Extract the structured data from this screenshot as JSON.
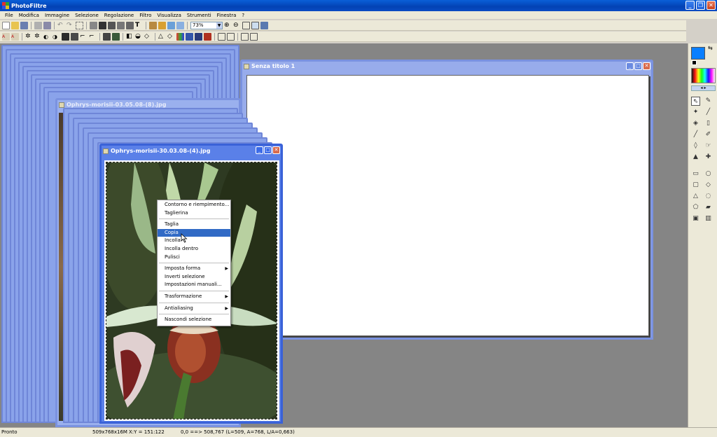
{
  "app": {
    "title": "PhotoFiltre"
  },
  "menu": [
    "File",
    "Modifica",
    "Immagine",
    "Selezione",
    "Regolazione",
    "Filtro",
    "Visualizza",
    "Strumenti",
    "Finestra",
    "?"
  ],
  "toolbar": {
    "zoom": "73%"
  },
  "windows": {
    "blank": {
      "title": "Senza titolo 1"
    },
    "back": {
      "title": "Ophrys-morisii-03.05.08-(8).jpg"
    },
    "active": {
      "title": "Ophrys-morisii-30.03.08-(4).jpg"
    }
  },
  "context_menu": {
    "items": [
      {
        "label": "Contorno e riempimento..."
      },
      {
        "label": "Taglierina"
      },
      {
        "label": "Taglia"
      },
      {
        "label": "Copia",
        "highlighted": true
      },
      {
        "label": "Incolla"
      },
      {
        "label": "Incolla dentro"
      },
      {
        "label": "Pulisci"
      },
      {
        "label": "Imposta forma",
        "submenu": true
      },
      {
        "label": "Inverti selezione"
      },
      {
        "label": "Impostazioni manuali..."
      },
      {
        "label": "Trasformazione",
        "submenu": true
      },
      {
        "label": "Antialiasing",
        "submenu": true
      },
      {
        "label": "Nascondi selezione"
      }
    ]
  },
  "status": {
    "state": "Pronto",
    "size": "509x768x16M",
    "xy": "X:Y = 151:122",
    "selection": "0,0 ==> 508,767 (L=509, A=768, L/A=0,663)"
  },
  "colors": {
    "foreground": "#0a7fff",
    "background": "#ffffff",
    "titlebar": "#0342b4",
    "menu_highlight": "#316ac5"
  }
}
